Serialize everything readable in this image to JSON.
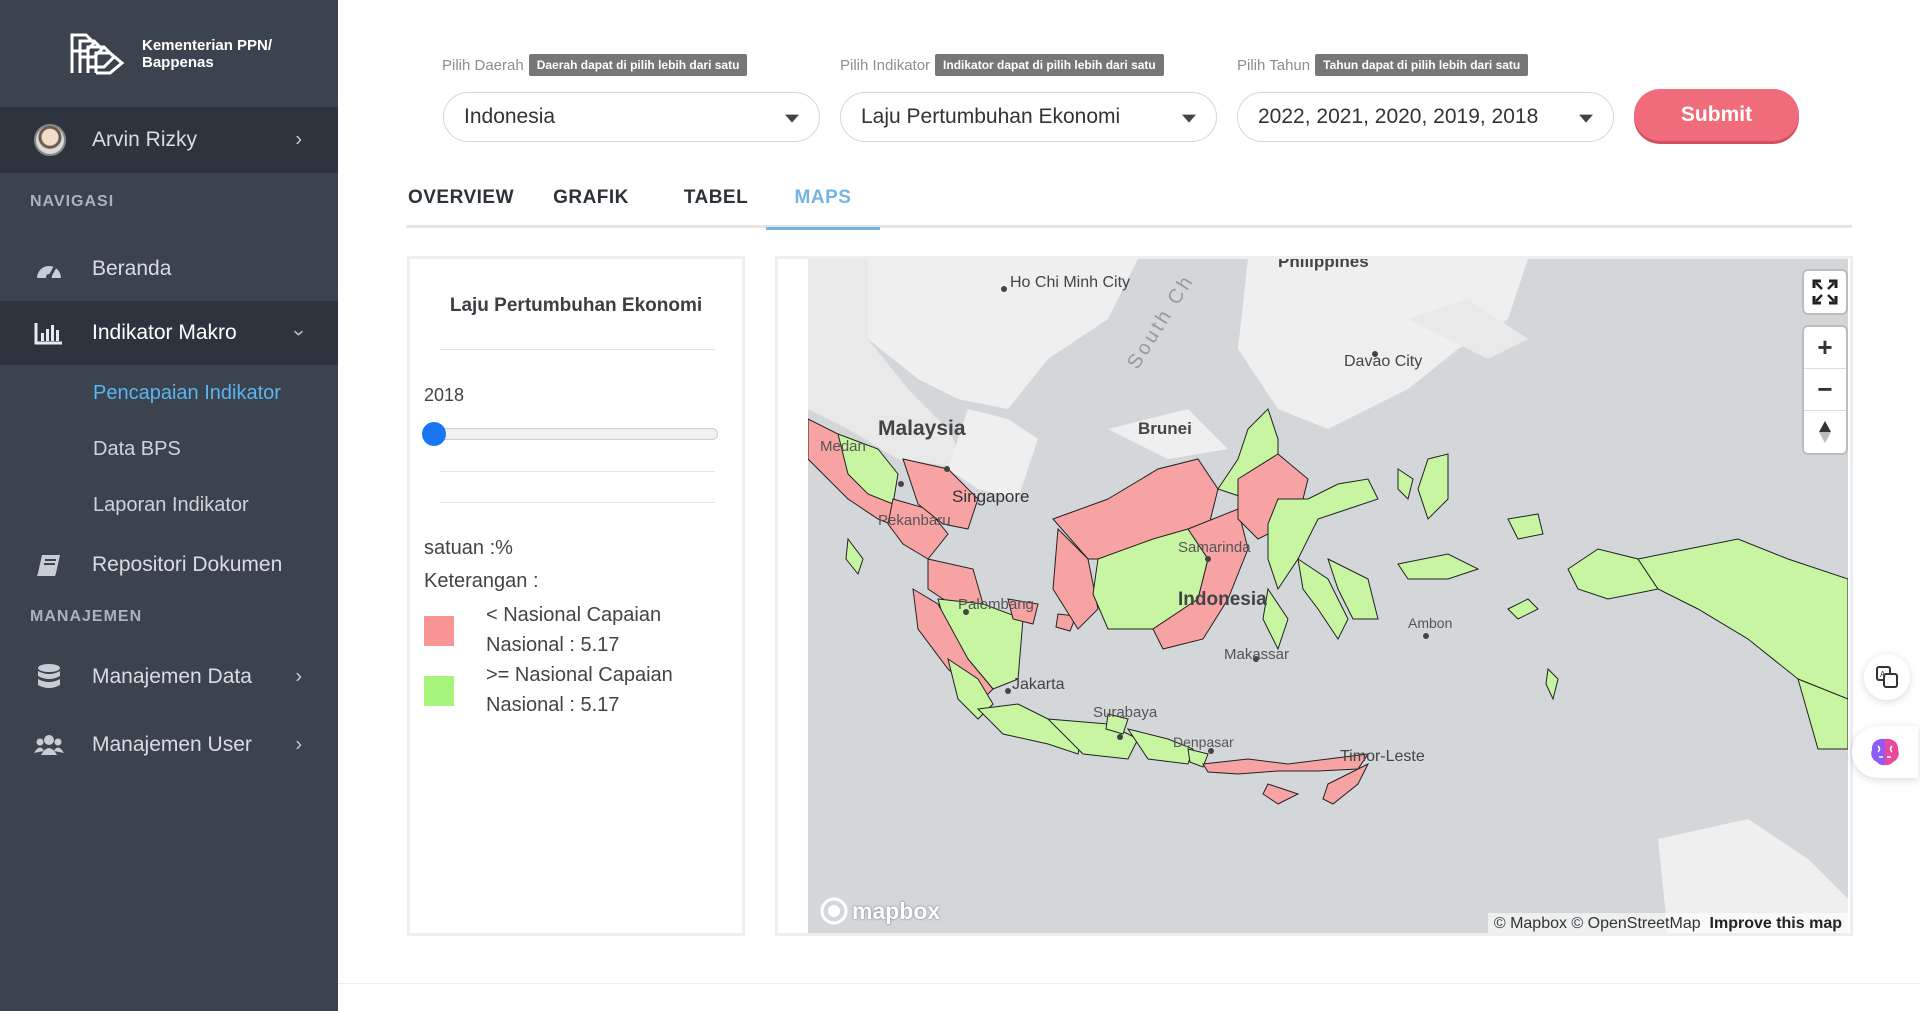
{
  "brand": {
    "name_line1": "Kementerian PPN/",
    "name_line2": "Bappenas",
    "logo_icon": "bappenas-logo-icon"
  },
  "user": {
    "name": "Arvin Rizky"
  },
  "sidebar": {
    "section_nav": "NAVIGASI",
    "section_manage": "MANAJEMEN",
    "items": [
      {
        "label": "Beranda",
        "icon": "dashboard-icon"
      },
      {
        "label": "Indikator Makro",
        "icon": "bar-chart-icon"
      },
      {
        "label": "Repositori Dokumen",
        "icon": "book-icon"
      },
      {
        "label": "Manajemen Data",
        "icon": "database-icon"
      },
      {
        "label": "Manajemen User",
        "icon": "users-icon"
      }
    ],
    "subitems": [
      {
        "label": "Pencapaian Indikator",
        "active": true
      },
      {
        "label": "Data BPS"
      },
      {
        "label": "Laporan Indikator"
      }
    ]
  },
  "filters": {
    "daerah": {
      "label": "Pilih Daerah",
      "hint": "Daerah dapat di pilih lebih dari satu",
      "value": "Indonesia"
    },
    "indikator": {
      "label": "Pilih Indikator",
      "hint": "Indikator dapat di pilih lebih dari satu",
      "value": "Laju Pertumbuhan Ekonomi"
    },
    "tahun": {
      "label": "Pilih Tahun",
      "hint": "Tahun dapat di pilih lebih dari satu",
      "value": "2022, 2021, 2020, 2019, 2018"
    },
    "submit_label": "Submit"
  },
  "tabs": [
    {
      "label": "OVERVIEW"
    },
    {
      "label": "GRAFIK"
    },
    {
      "label": "TABEL"
    },
    {
      "label": "MAPS",
      "active": true
    }
  ],
  "legend": {
    "title": "Laju Pertumbuhan Ekonomi",
    "year": "2018",
    "slider_fraction": 0.0,
    "satuan": "satuan :%",
    "keterangan": "Keterangan :",
    "items": [
      {
        "line1": "< Nasional Capaian",
        "line2": "Nasional : 5.17",
        "color": "#f99595"
      },
      {
        "line1": ">= Nasional Capaian",
        "line2": "Nasional : 5.17",
        "color": "#a6f57a"
      }
    ]
  },
  "map": {
    "labels": {
      "hcmc": "Ho Chi Minh City",
      "sea": "South Ch",
      "philippines": "Philippines",
      "davao": "Davao City",
      "malaysia": "Malaysia",
      "brunei": "Brunei",
      "medan": "Medan",
      "singapore": "Singapore",
      "pekanbaru": "Pekanbaru",
      "samarinda": "Samarinda",
      "indonesia": "Indonesia",
      "palembang": "Palembang",
      "makassar": "Makassar",
      "jakarta": "Jakarta",
      "surabaya": "Surabaya",
      "denpasar": "Denpasar",
      "timor": "Timor-Leste",
      "ambon": "Ambon"
    },
    "attribution": "© Mapbox © OpenStreetMap",
    "improve": "Improve this map",
    "mapbox": "mapbox",
    "colors": {
      "below": "#f7a3a3",
      "above": "#c8f5a2",
      "water": "#d4d7d9",
      "land": "#efefef"
    }
  }
}
